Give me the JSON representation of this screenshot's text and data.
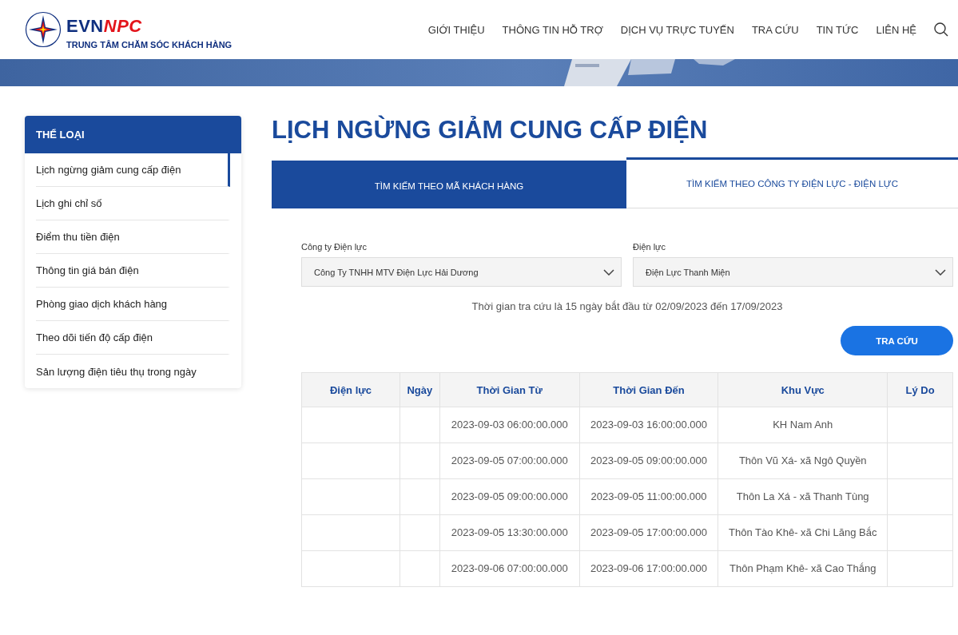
{
  "header": {
    "logo": {
      "part_1": "EVN",
      "part_2": "NPC",
      "subtitle": "TRUNG TÂM CHĂM SÓC KHÁCH HÀNG"
    },
    "nav": [
      "GIỚI THIỆU",
      "THÔNG TIN HỖ TRỢ",
      "DỊCH VỤ TRỰC TUYẾN",
      "TRA CỨU",
      "TIN TỨC",
      "LIÊN HỆ"
    ]
  },
  "sidebar": {
    "title": "THỂ LOẠI",
    "items": [
      {
        "label": "Lịch ngừng giảm cung cấp điện",
        "selected": true
      },
      {
        "label": "Lịch ghi chỉ số",
        "selected": false
      },
      {
        "label": "Điểm thu tiền điện",
        "selected": false
      },
      {
        "label": "Thông tin giá bán điện",
        "selected": false
      },
      {
        "label": "Phòng giao dịch khách hàng",
        "selected": false
      },
      {
        "label": "Theo dõi tiến độ cấp điện",
        "selected": false
      },
      {
        "label": "Sản lượng điện tiêu thụ trong ngày",
        "selected": false
      }
    ]
  },
  "page_title": "LỊCH NGỪNG GIẢM CUNG CẤP ĐIỆN",
  "tabs": [
    {
      "label": "TÌM KIẾM THEO MÃ KHÁCH HÀNG",
      "selected": true
    },
    {
      "label": "TÌM KIẾM THEO CÔNG TY ĐIỆN LỰC - ĐIỆN LỰC",
      "selected": false
    }
  ],
  "form": {
    "fields": [
      {
        "label": "Công ty Điện lực",
        "value": "Công Ty TNHH MTV Điện Lực Hải Dương"
      },
      {
        "label": "Điện lực",
        "value": "Điện Lực Thanh Miện"
      }
    ],
    "info": "Thời gian tra cứu là 15 ngày bắt đầu từ 02/09/2023 đến 17/09/2023",
    "button": "TRA CỨU"
  },
  "table": {
    "columns": [
      "Điện lực",
      "Ngày",
      "Thời Gian Từ",
      "Thời Gian Đến",
      "Khu Vực",
      "Lý Do"
    ],
    "rows": [
      [
        "",
        "",
        "2023-09-03 06:00:00.000",
        "2023-09-03 16:00:00.000",
        "KH Nam Anh",
        ""
      ],
      [
        "",
        "",
        "2023-09-05 07:00:00.000",
        "2023-09-05 09:00:00.000",
        "Thôn Vũ Xá- xã Ngô Quyền",
        ""
      ],
      [
        "",
        "",
        "2023-09-05 09:00:00.000",
        "2023-09-05 11:00:00.000",
        "Thôn La Xá - xã Thanh Tùng",
        ""
      ],
      [
        "",
        "",
        "2023-09-05 13:30:00.000",
        "2023-09-05 17:00:00.000",
        "Thôn Tào Khê- xã Chi Lăng Bắc",
        ""
      ],
      [
        "",
        "",
        "2023-09-06 07:00:00.000",
        "2023-09-06 17:00:00.000",
        "Thôn Phạm Khê- xã Cao Thắng",
        ""
      ]
    ]
  }
}
